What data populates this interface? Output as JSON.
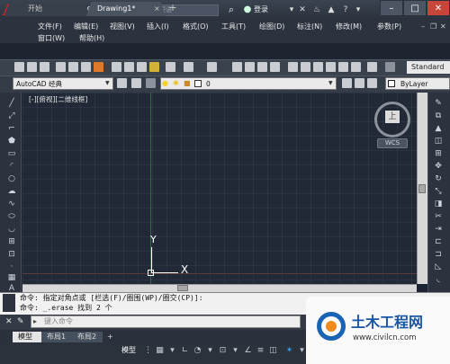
{
  "titlebar": {
    "logo": "A",
    "document_title": "Drawing1.dwg",
    "search_placeholder": "键入关键字或短语",
    "login_label": "登录"
  },
  "menu": {
    "row1": [
      "文件(F)",
      "编辑(E)",
      "视图(V)",
      "插入(I)",
      "格式(O)",
      "工具(T)",
      "绘图(D)",
      "标注(N)",
      "修改(M)",
      "参数(P)"
    ],
    "row2": [
      "窗口(W)",
      "帮助(H)"
    ]
  },
  "tabs": {
    "start": "开始",
    "drawing": "Drawing1*",
    "close": "×",
    "add": "+"
  },
  "toolbar": {
    "text_style": "Standard",
    "workspace": "AutoCAD 经典",
    "layer_value": "0",
    "linetype": "ByLayer"
  },
  "canvas": {
    "viewport_label": "[-][俯视][二维线框]",
    "viewcube_face": "上",
    "wcs_label": "WCS",
    "ucs_y": "Y",
    "ucs_x": "X"
  },
  "command": {
    "line1": "命令: 指定对角点或 [栏选(F)/圈围(WP)/圈交(CP)]:",
    "line2": "命令: _.erase 找到 2 个",
    "input_placeholder": "键入命令"
  },
  "layout_tabs": [
    "模型",
    "布局1",
    "布局2"
  ],
  "layout_add": "+",
  "status": {
    "model": "模型"
  },
  "watermark": {
    "title": "土木工程网",
    "url": "www.civilcn.com"
  },
  "colors": {
    "accent": "#c7463a",
    "canvas": "#212836",
    "watermark_blue": "#1a55a3"
  }
}
